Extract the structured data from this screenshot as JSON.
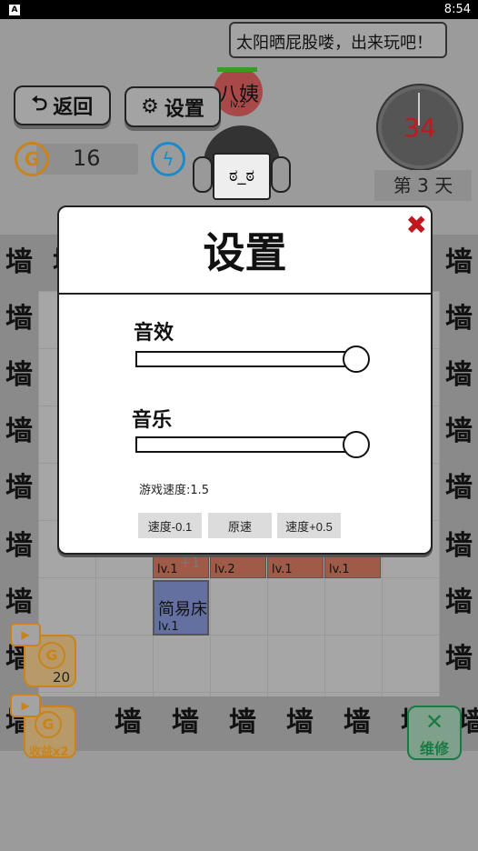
{
  "status_bar": {
    "time": "8:54",
    "app_icon": "A"
  },
  "speech_bubble": "太阳晒屁股喽，出来玩吧！",
  "npc": {
    "name": "八姨",
    "level": "lv.2"
  },
  "toolbar": {
    "back_label": "返回",
    "settings_label": "设置"
  },
  "resources": {
    "coins": "16",
    "coin_icon": "G"
  },
  "timer": {
    "value": "34",
    "day_label": "第 3 天"
  },
  "wall_label": "墙",
  "tiles": [
    {
      "label": "lv.1",
      "bonus": "+1"
    },
    {
      "label": "lv.2"
    },
    {
      "label": "lv.1"
    },
    {
      "label": "lv.1"
    }
  ],
  "bed": {
    "name": "简易床",
    "level": "lv.1"
  },
  "ads": {
    "coins_amount": "20",
    "income_label": "收益x2"
  },
  "repair_label": "维修",
  "dialog": {
    "title": "设置",
    "sound_effects": {
      "label": "音效",
      "value": 100
    },
    "music": {
      "label": "音乐",
      "value": 100
    },
    "speed_text": "游戏速度:1.5",
    "buttons": [
      "速度-0.1",
      "原速",
      "速度+0.5"
    ]
  },
  "colors": {
    "accent_red": "#c0181e",
    "coin": "#c8841a",
    "repair": "#1a7a45",
    "bed": "#6470a0"
  }
}
